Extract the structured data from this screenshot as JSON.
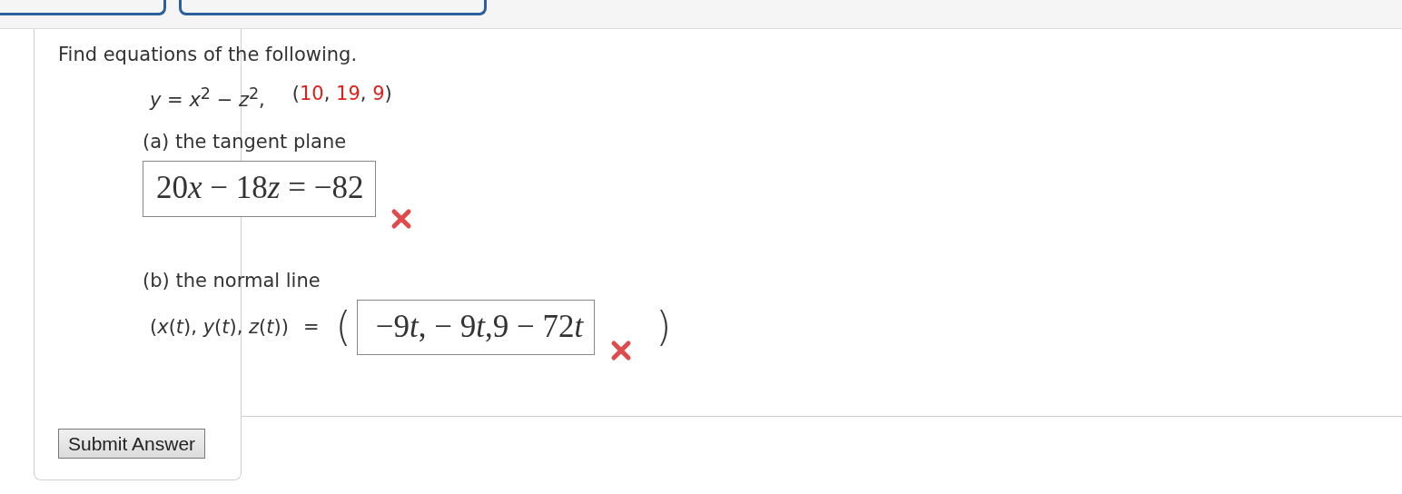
{
  "instruction": "Find equations of the following.",
  "surface": {
    "equation": "*y* = *x*$^{2}$ − *z*$^{2}$,",
    "point": [
      {
        "text": "(",
        "color": "#333333"
      },
      {
        "text": "10",
        "color": "#e0201b"
      },
      {
        "text": ", ",
        "color": "#333333"
      },
      {
        "text": "19",
        "color": "#e0201b"
      },
      {
        "text": ", ",
        "color": "#333333"
      },
      {
        "text": "9",
        "color": "#e0201b"
      },
      {
        "text": ")",
        "color": "#333333"
      }
    ]
  },
  "parts": [
    {
      "kind": "equation",
      "label": "(a) the tangent plane",
      "answer": [
        {
          "text": "20",
          "italic": false
        },
        {
          "text": "x",
          "italic": true
        },
        {
          "text": " − 18",
          "italic": false
        },
        {
          "text": "z",
          "italic": true
        },
        {
          "text": " = −82",
          "italic": false
        }
      ],
      "correct": false
    },
    {
      "kind": "tuple",
      "label": "(b) the normal line",
      "lhs": "(*x*(*t*), *y*(*t*), *z*(*t*))",
      "equals": "=",
      "open": "(",
      "answer": [
        {
          "text": "−9",
          "italic": false
        },
        {
          "text": "t",
          "italic": true
        },
        {
          "text": ", − 9",
          "italic": false
        },
        {
          "text": "t",
          "italic": true
        },
        {
          "text": ",9 − 72",
          "italic": false
        },
        {
          "text": "t",
          "italic": true
        }
      ],
      "close": ")",
      "correct": false
    }
  ],
  "submit": {
    "label": "Submit Answer"
  }
}
